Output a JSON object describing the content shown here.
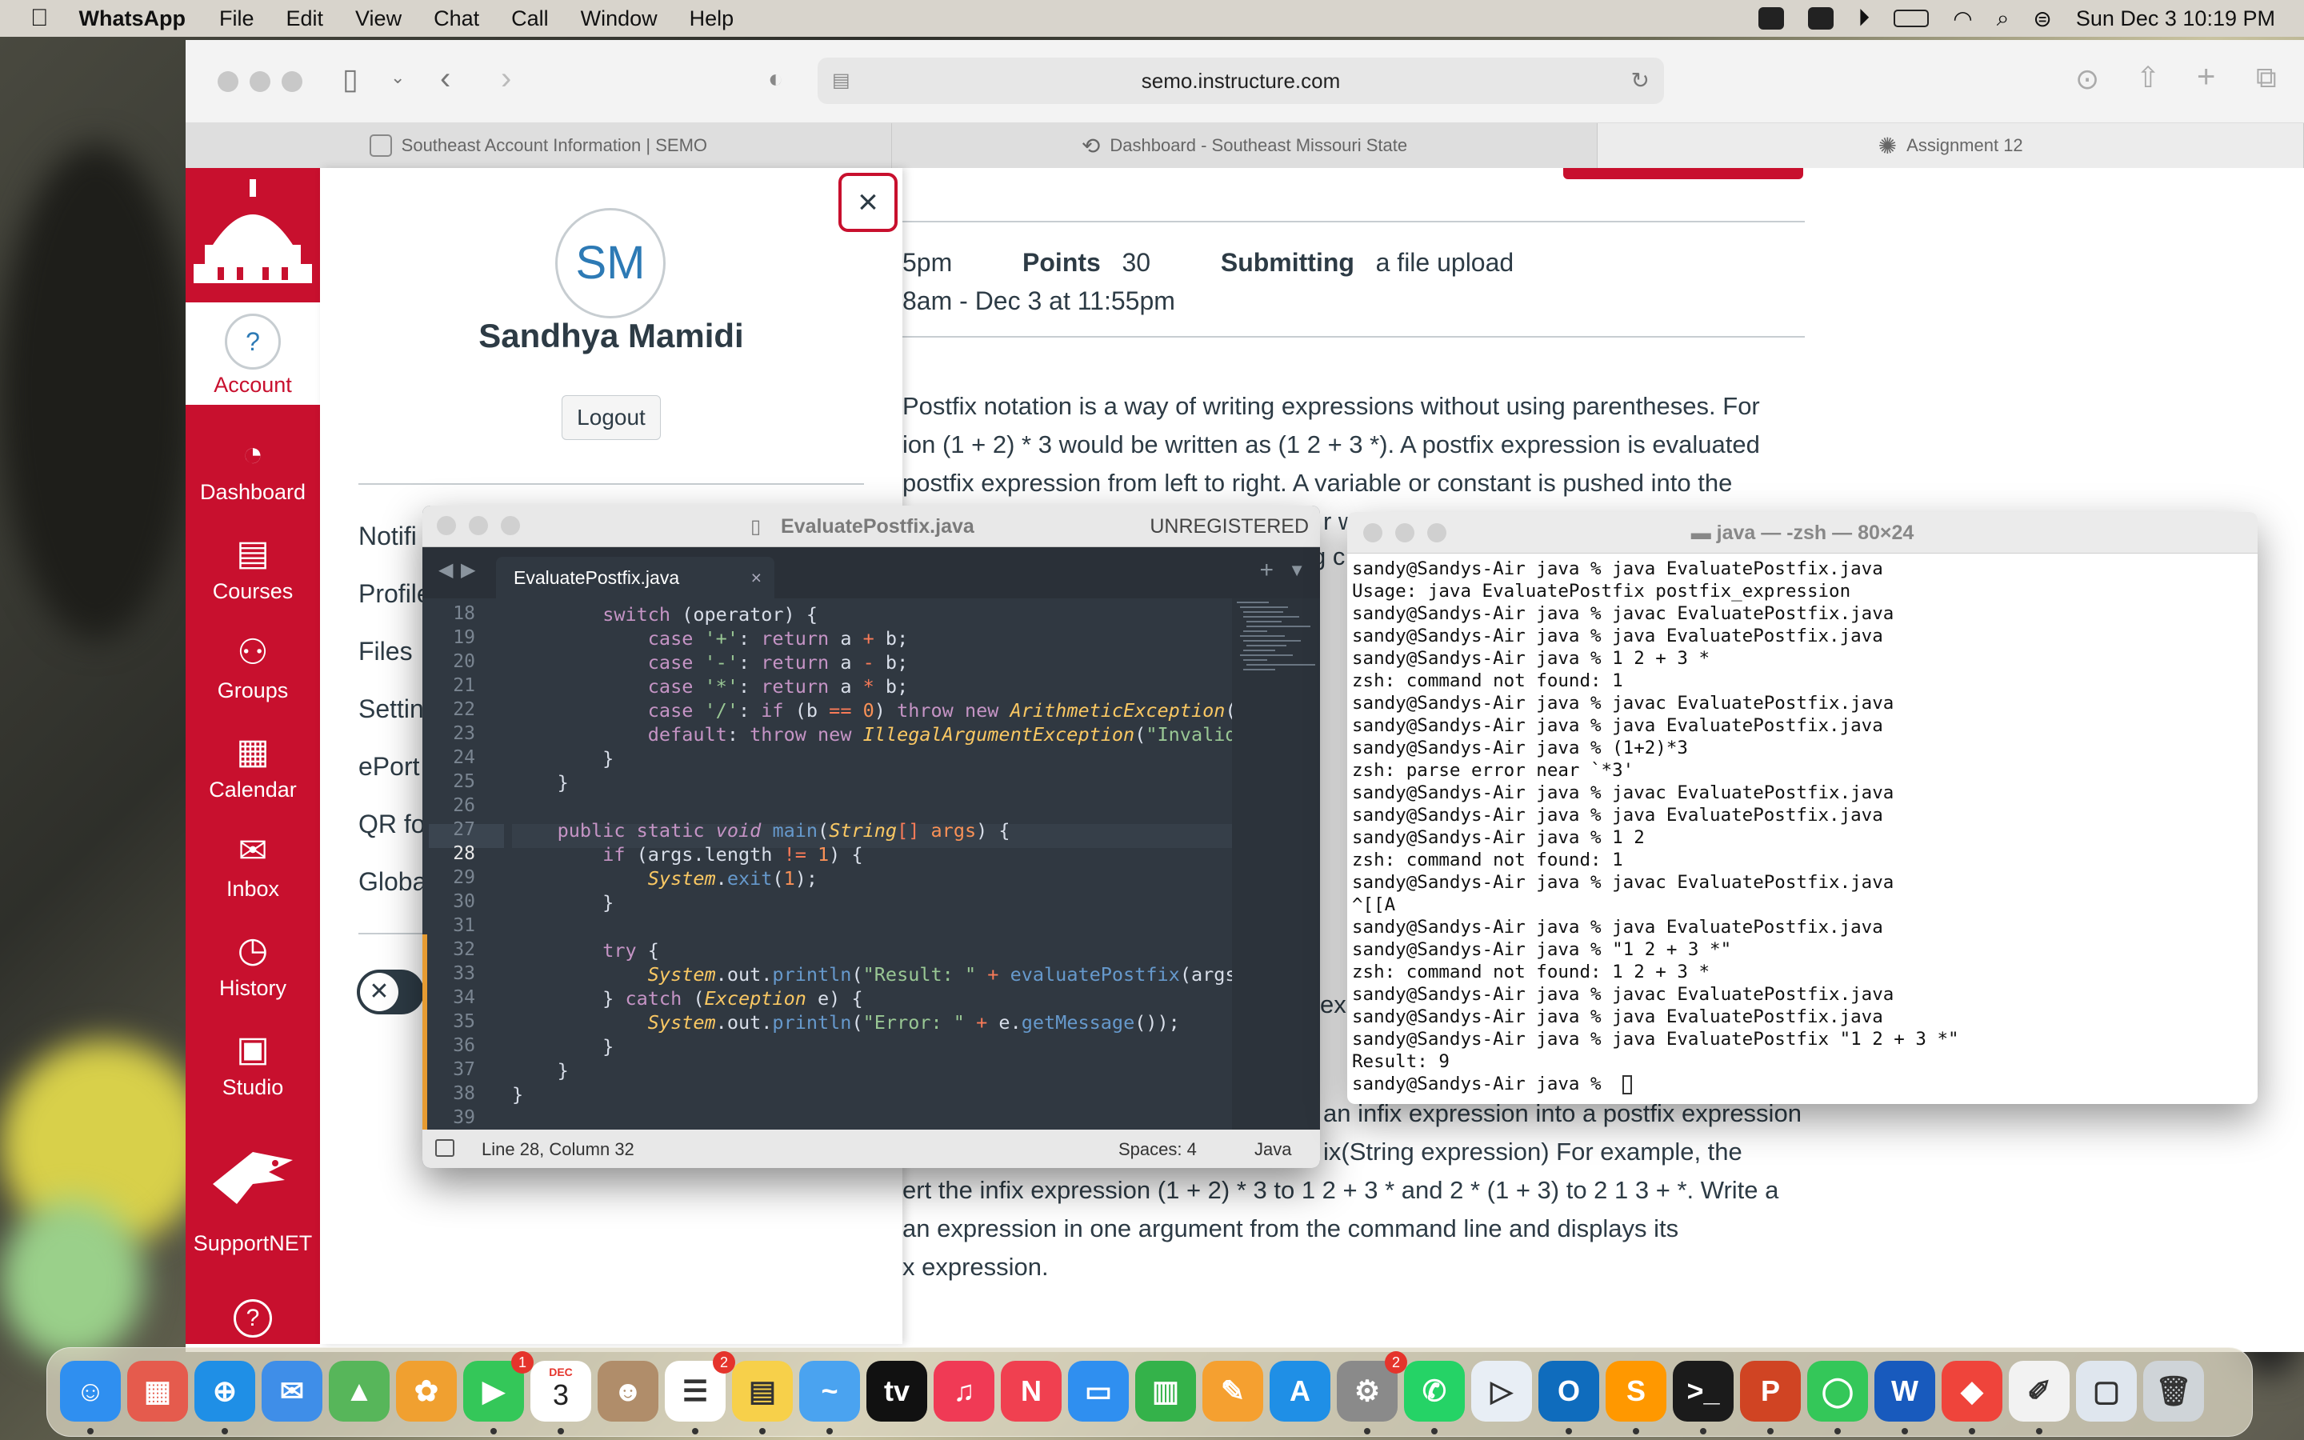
{
  "menubar": {
    "apple": "",
    "app_name": "WhatsApp",
    "items": [
      "File",
      "Edit",
      "View",
      "Chat",
      "Call",
      "Window",
      "Help"
    ],
    "clock": "Sun Dec 3  10:19 PM"
  },
  "safari": {
    "url": "semo.instructure.com",
    "tabs": [
      {
        "label": "Southeast Account Information | SEMO"
      },
      {
        "label": "Dashboard - Southeast Missouri State"
      },
      {
        "label": "Assignment 12"
      }
    ]
  },
  "canvas_nav": [
    {
      "label": "Account",
      "glyph": "?"
    },
    {
      "label": "Dashboard",
      "glyph": "◔"
    },
    {
      "label": "Courses",
      "glyph": "▤"
    },
    {
      "label": "Groups",
      "glyph": "⚇"
    },
    {
      "label": "Calendar",
      "glyph": "▦"
    },
    {
      "label": "Inbox",
      "glyph": "✉"
    },
    {
      "label": "History",
      "glyph": "◷"
    },
    {
      "label": "Studio",
      "glyph": "▣"
    },
    {
      "label": "SupportNET",
      "glyph": ""
    },
    {
      "label": "",
      "glyph": "?"
    }
  ],
  "account_tray": {
    "initials": "SM",
    "name": "Sandhya Mamidi",
    "logout": "Logout",
    "close": "×",
    "links": [
      "Notifi",
      "Profile",
      "Files",
      "Settin",
      "ePort",
      "QR fo",
      "Globa"
    ],
    "toggle_glyph": "✕"
  },
  "assignment": {
    "due_partial": "5pm",
    "points_label": "Points",
    "points_value": "30",
    "submitting_label": "Submitting",
    "submitting_value": "a file upload",
    "available": "8am - Dec 3 at 11:55pm",
    "para1": [
      "Postfix notation is a way of writing expressions without using parentheses. For",
      "ion (1 + 2) * 3 would be written as (1 2 + 3 *). A postfix expression is evaluated",
      "postfix expression from left to right. A variable or constant is pushed into the",
      "r w"
    ],
    "para1_tail": "g c",
    "para2_fragment": "ex",
    "para3": [
      "an infix expression into a postfix expression",
      "ix(String expression) For example, the",
      "ert the infix expression (1 + 2) * 3 to 1 2 + 3 * and 2 * (1 + 3) to 2 1 3 + *. Write a",
      "an expression in one argument from the command line and displays its",
      "x expression."
    ]
  },
  "sublime": {
    "title": "EvaluatePostfix.java",
    "unregistered": "UNREGISTERED",
    "tab": "EvaluatePostfix.java",
    "tab_close": "×",
    "status_position": "Line 28, Column 32",
    "status_spaces": "Spaces: 4",
    "status_syntax": "Java",
    "line_numbers": [
      "18",
      "19",
      "20",
      "21",
      "22",
      "23",
      "24",
      "25",
      "26",
      "27",
      "28",
      "29",
      "30",
      "31",
      "32",
      "33",
      "34",
      "35",
      "36",
      "37",
      "38",
      "39"
    ]
  },
  "terminal": {
    "title": "java — -zsh — 80×24",
    "lines": [
      "sandy@Sandys-Air java % java EvaluatePostfix.java",
      "Usage: java EvaluatePostfix postfix_expression",
      "sandy@Sandys-Air java % javac EvaluatePostfix.java",
      "sandy@Sandys-Air java % java EvaluatePostfix.java",
      "sandy@Sandys-Air java % 1 2 + 3 *",
      "zsh: command not found: 1",
      "sandy@Sandys-Air java % javac EvaluatePostfix.java",
      "sandy@Sandys-Air java % java EvaluatePostfix.java",
      "sandy@Sandys-Air java % (1+2)*3",
      "zsh: parse error near `*3'",
      "sandy@Sandys-Air java % javac EvaluatePostfix.java",
      "sandy@Sandys-Air java % java EvaluatePostfix.java",
      "sandy@Sandys-Air java % 1 2",
      "zsh: command not found: 1",
      "sandy@Sandys-Air java % javac EvaluatePostfix.java",
      "^[[A",
      "sandy@Sandys-Air java % java EvaluatePostfix.java",
      "sandy@Sandys-Air java % \"1 2 + 3 *\"",
      "zsh: command not found: 1 2 + 3 *",
      "sandy@Sandys-Air java % javac EvaluatePostfix.java",
      "sandy@Sandys-Air java % java EvaluatePostfix.java",
      "sandy@Sandys-Air java % java EvaluatePostfix \"1 2 + 3 *\"",
      "Result: 9",
      "sandy@Sandys-Air java % "
    ]
  },
  "dock": {
    "calendar_month": "DEC",
    "calendar_day": "3",
    "badges": {
      "facetime": "1",
      "reminders": "2",
      "settings": "2"
    },
    "apps": [
      {
        "name": "finder",
        "glyph": "☺",
        "color": "#2f8ff0"
      },
      {
        "name": "launchpad",
        "glyph": "▦",
        "color": "#e55b4d"
      },
      {
        "name": "safari",
        "glyph": "⊕",
        "color": "#1f8fe6"
      },
      {
        "name": "mail",
        "glyph": "✉",
        "color": "#3f8ee8"
      },
      {
        "name": "maps",
        "glyph": "▲",
        "color": "#57b65a"
      },
      {
        "name": "photos",
        "glyph": "✿",
        "color": "#f0a030"
      },
      {
        "name": "facetime",
        "glyph": "▶",
        "color": "#34c759"
      },
      {
        "name": "calendar",
        "glyph": "",
        "color": "#ffffff"
      },
      {
        "name": "contacts",
        "glyph": "☻",
        "color": "#b08d6a"
      },
      {
        "name": "reminders",
        "glyph": "☰",
        "color": "#ffffff"
      },
      {
        "name": "notes",
        "glyph": "▤",
        "color": "#f7d04a"
      },
      {
        "name": "freeform",
        "glyph": "~",
        "color": "#4aa3f0"
      },
      {
        "name": "apple-tv",
        "glyph": "tv",
        "color": "#111111"
      },
      {
        "name": "music",
        "glyph": "♫",
        "color": "#f03a55"
      },
      {
        "name": "news",
        "glyph": "N",
        "color": "#f04050"
      },
      {
        "name": "keynote",
        "glyph": "▭",
        "color": "#2f8ff0"
      },
      {
        "name": "numbers",
        "glyph": "▥",
        "color": "#34b24a"
      },
      {
        "name": "pages",
        "glyph": "✎",
        "color": "#f5a030"
      },
      {
        "name": "app-store",
        "glyph": "A",
        "color": "#1f8fe6"
      },
      {
        "name": "system-settings",
        "glyph": "⚙",
        "color": "#8a8a8a"
      },
      {
        "name": "whatsapp",
        "glyph": "✆",
        "color": "#25d366"
      },
      {
        "name": "quicktime",
        "glyph": "▷",
        "color": "#e8eef5"
      },
      {
        "name": "outlook",
        "glyph": "O",
        "color": "#0f6cbd"
      },
      {
        "name": "sublime-text",
        "glyph": "S",
        "color": "#ff9800"
      },
      {
        "name": "terminal",
        "glyph": ">_",
        "color": "#1b1b1b"
      },
      {
        "name": "powerpoint",
        "glyph": "P",
        "color": "#d04423"
      },
      {
        "name": "messages",
        "glyph": "◯",
        "color": "#34c759"
      },
      {
        "name": "word",
        "glyph": "W",
        "color": "#185abd"
      },
      {
        "name": "anydesk",
        "glyph": "◆",
        "color": "#ef443b"
      },
      {
        "name": "textedit",
        "glyph": "✐",
        "color": "#f2f2f2"
      },
      {
        "name": "python-folder",
        "glyph": "▢",
        "color": "#dfe6ee"
      },
      {
        "name": "trash",
        "glyph": "🗑",
        "color": "#cfd4d8"
      }
    ]
  }
}
